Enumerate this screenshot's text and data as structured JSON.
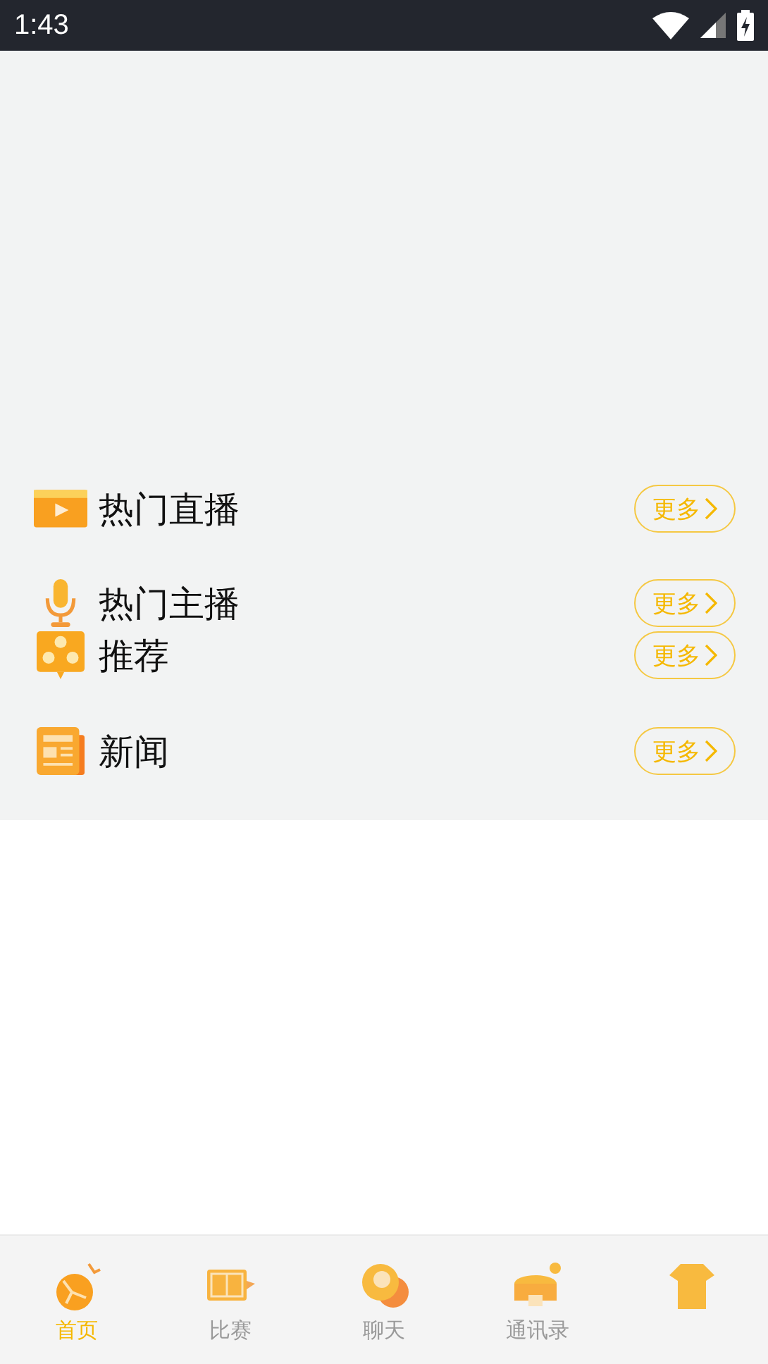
{
  "status_bar": {
    "time": "1:43"
  },
  "sections": [
    {
      "title": "热门直播",
      "more": "更多"
    },
    {
      "title": "热门主播",
      "more": "更多"
    },
    {
      "title": "推荐",
      "more": "更多"
    },
    {
      "title": "新闻",
      "more": "更多"
    }
  ],
  "tabs": [
    {
      "label": "首页",
      "selected": true
    },
    {
      "label": "比赛",
      "selected": false
    },
    {
      "label": "聊天",
      "selected": false
    },
    {
      "label": "通讯录",
      "selected": false
    },
    {
      "selected": false
    }
  ]
}
